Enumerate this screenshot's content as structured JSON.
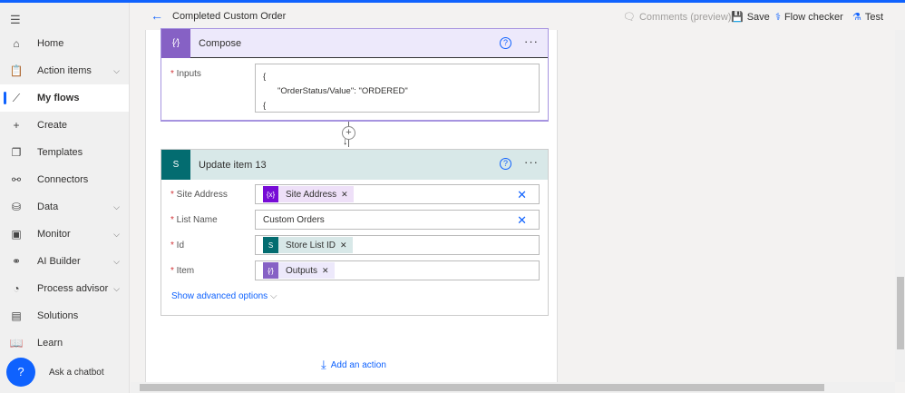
{
  "header": {
    "title": "Completed Custom Order",
    "comments": "Comments (preview)",
    "save": "Save",
    "flow_checker": "Flow checker",
    "test": "Test"
  },
  "sidebar": {
    "items": [
      {
        "label": "Home",
        "icon": "home-icon"
      },
      {
        "label": "Action items",
        "icon": "clipboard-icon",
        "chevron": true
      },
      {
        "label": "My flows",
        "icon": "flow-icon",
        "active": true
      },
      {
        "label": "Create",
        "icon": "plus-icon"
      },
      {
        "label": "Templates",
        "icon": "templates-icon"
      },
      {
        "label": "Connectors",
        "icon": "connector-icon"
      },
      {
        "label": "Data",
        "icon": "database-icon",
        "chevron": true
      },
      {
        "label": "Monitor",
        "icon": "monitor-icon",
        "chevron": true
      },
      {
        "label": "AI Builder",
        "icon": "ai-icon",
        "chevron": true
      },
      {
        "label": "Process advisor",
        "icon": "process-icon",
        "chevron": true
      },
      {
        "label": "Solutions",
        "icon": "solutions-icon"
      },
      {
        "label": "Learn",
        "icon": "book-icon"
      }
    ],
    "chatbot": "Ask a chatbot"
  },
  "compose": {
    "title": "Compose",
    "inputs_label": "Inputs",
    "line1": "{",
    "line2": "\"OrderStatus/Value\": \"ORDERED\"",
    "line3": "{",
    "color": "#8661c5"
  },
  "update": {
    "title": "Update item 13",
    "color": "#036c70",
    "site_label": "Site Address",
    "site_token": "Site Address",
    "list_label": "List Name",
    "list_value": "Custom Orders",
    "id_label": "Id",
    "id_token": "Store List ID",
    "item_label": "Item",
    "item_token": "Outputs",
    "advanced": "Show advanced options"
  },
  "add_action": "Add an action"
}
